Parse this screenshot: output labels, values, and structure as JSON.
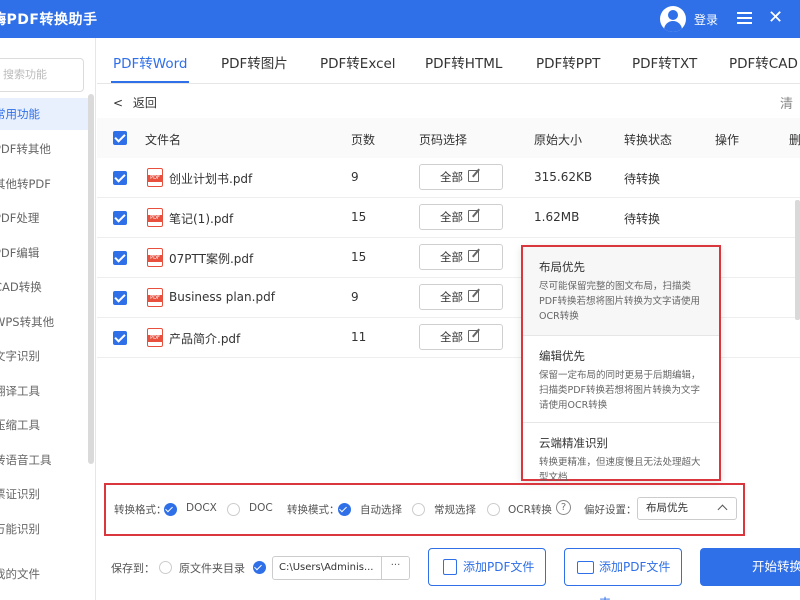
{
  "app": {
    "title": "嗨PDF转换助手",
    "login": "登录",
    "close_glyph": "✕",
    "menu_glyph": "≡"
  },
  "sidebar": {
    "search_placeholder": "搜索功能",
    "items": [
      {
        "label": "常用功能",
        "active": true
      },
      {
        "label": "PDF转其他",
        "active": false
      },
      {
        "label": "其他转PDF",
        "active": false
      },
      {
        "label": "PDF处理",
        "active": false
      },
      {
        "label": "PDF编辑",
        "active": false
      },
      {
        "label": "CAD转换",
        "active": false
      },
      {
        "label": "WPS转其他",
        "active": false
      },
      {
        "label": "文字识别",
        "active": false
      },
      {
        "label": "翻译工具",
        "active": false
      },
      {
        "label": "压缩工具",
        "active": false
      },
      {
        "label": "转语音工具",
        "active": false
      },
      {
        "label": "票证识别",
        "active": false
      },
      {
        "label": "万能识别",
        "active": false
      },
      {
        "label": "我的文件",
        "active": false
      }
    ]
  },
  "tabs": [
    "PDF转Word",
    "PDF转图片",
    "PDF转Excel",
    "PDF转HTML",
    "PDF转PPT",
    "PDF转TXT",
    "PDF转CAD"
  ],
  "active_tab": 0,
  "back_label": "返回",
  "back_glyph": "<",
  "trash_label": "清",
  "table": {
    "headers": [
      "文件名",
      "页数",
      "页码选择",
      "原始大小",
      "转换状态",
      "操作",
      "删"
    ],
    "page_select_label": "全部",
    "rows": [
      {
        "name": "创业计划书.pdf",
        "pages": "9",
        "size": "315.62KB",
        "status": "待转换"
      },
      {
        "name": "笔记(1).pdf",
        "pages": "15",
        "size": "1.62MB",
        "status": "待转换"
      },
      {
        "name": "07PTT案例.pdf",
        "pages": "15",
        "size": "",
        "status": ""
      },
      {
        "name": "Business plan.pdf",
        "pages": "9",
        "size": "",
        "status": ""
      },
      {
        "name": "产品简介.pdf",
        "pages": "11",
        "size": "",
        "status": ""
      }
    ]
  },
  "popup": {
    "options": [
      {
        "title": "布局优先",
        "desc": "尽可能保留完整的图文布局，扫描类PDF转换若想将图片转换为文字请使用OCR转换"
      },
      {
        "title": "编辑优先",
        "desc": "保留一定布局的同时更易于后期编辑，扫描类PDF转换若想将图片转换为文字请使用OCR转换"
      },
      {
        "title": "云端精准识别",
        "desc": "转换更精准，但速度慢且无法处理超大型文档"
      }
    ]
  },
  "settings": {
    "format_label": "转换格式：",
    "format_docx": "DOCX",
    "format_doc": "DOC",
    "mode_label": "转换模式：",
    "mode_auto": "自动选择",
    "mode_normal": "常规选择",
    "mode_ocr": "OCR转换",
    "help_glyph": "?",
    "pref_label": "偏好设置：",
    "pref_value": "布局优先"
  },
  "bottom": {
    "save_label": "保存到：",
    "source_dir": "原文件夹目录",
    "path": "C:\\Users\\Adminis...",
    "path_more": "···",
    "add_file": "添加PDF文件",
    "add_folder": "添加PDF文件夹",
    "start": "开始转换"
  },
  "colors": {
    "primary": "#2f6fe8",
    "highlight_border": "#d9363e"
  }
}
